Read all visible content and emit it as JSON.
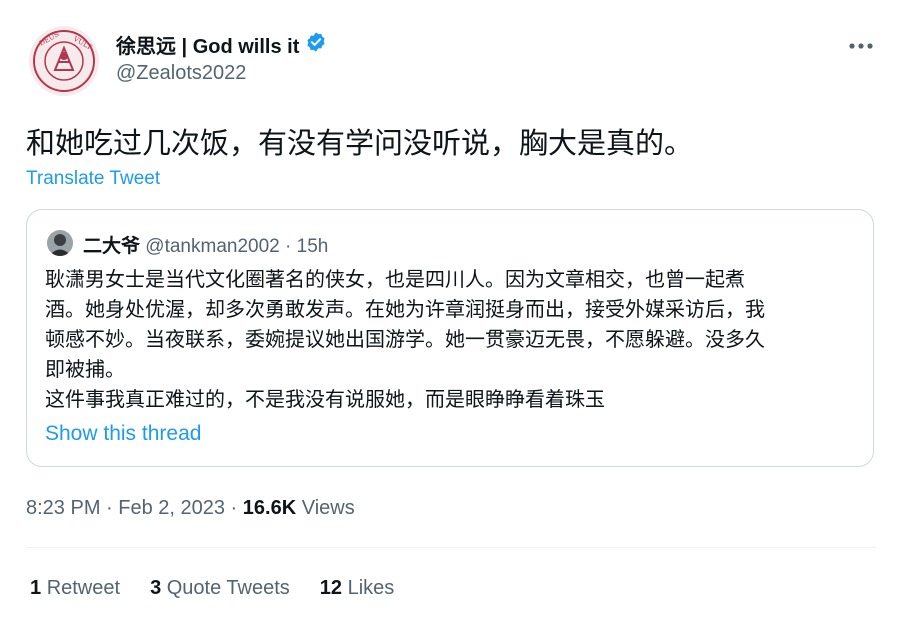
{
  "author": {
    "display_name": "徐思远 | God wills it",
    "handle": "@Zealots2022",
    "verified_icon": "verified-badge-icon",
    "avatar_seal_text": "DEUS VULT"
  },
  "tweet": {
    "text": "和她吃过几次饭，有没有学问没听说，胸大是真的。",
    "translate_label": "Translate Tweet",
    "timestamp": "8:23 PM · Feb 2, 2023 · ",
    "views_count": "16.6K",
    "views_label": " Views"
  },
  "quoted": {
    "name": "二大爷",
    "handle": "@tankman2002",
    "sep": " · ",
    "age": "15h",
    "lines": [
      "耿潇男女士是当代文化圈著名的侠女，也是四川人。因为文章相交，也曾一起煮",
      "酒。她身处优渥，却多次勇敢发声。在她为许章润挺身而出，接受外媒采访后，我",
      "顿感不妙。当夜联系，委婉提议她出国游学。她一贯豪迈无畏，不愿躲避。没多久",
      "即被捕。",
      "这件事我真正难过的，不是我没有说服她，而是眼睁睁看着珠玉"
    ],
    "show_thread": "Show this thread"
  },
  "stats": {
    "retweets_count": "1",
    "retweets_label": "Retweet",
    "quotes_count": "3",
    "quotes_label": "Quote Tweets",
    "likes_count": "12",
    "likes_label": "Likes"
  },
  "icons": {
    "more": "more-options-icon"
  },
  "colors": {
    "accent": "#1d9bf0",
    "secondary_text": "#536471",
    "border": "#cfd9de"
  }
}
